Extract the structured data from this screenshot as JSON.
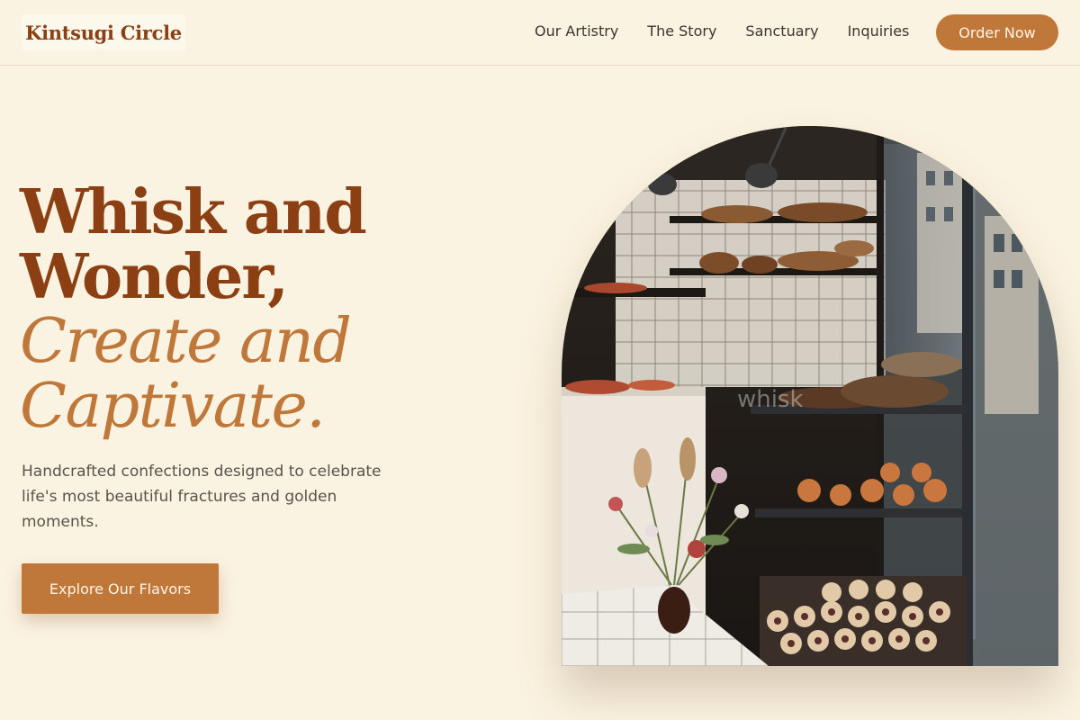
{
  "brand": {
    "name": "Kintsugi Circle"
  },
  "nav": {
    "items": [
      {
        "label": "Our Artistry"
      },
      {
        "label": "The Story"
      },
      {
        "label": "Sanctuary"
      },
      {
        "label": "Inquiries"
      }
    ],
    "cta_label": "Order Now"
  },
  "hero": {
    "headline": {
      "line1": "Whisk and",
      "line2": "Wonder,",
      "line3": "Create and",
      "line4": "Captivate."
    },
    "subtitle": "Handcrafted confections designed to celebrate life's most beautiful fractures and golden moments.",
    "cta_label": "Explore Our Flavors",
    "image_window_text": "whisk"
  },
  "colors": {
    "background": "#fbf3e1",
    "primary_brown": "#8b3f12",
    "accent_copper": "#c0783a",
    "body_text": "#5b524c"
  }
}
